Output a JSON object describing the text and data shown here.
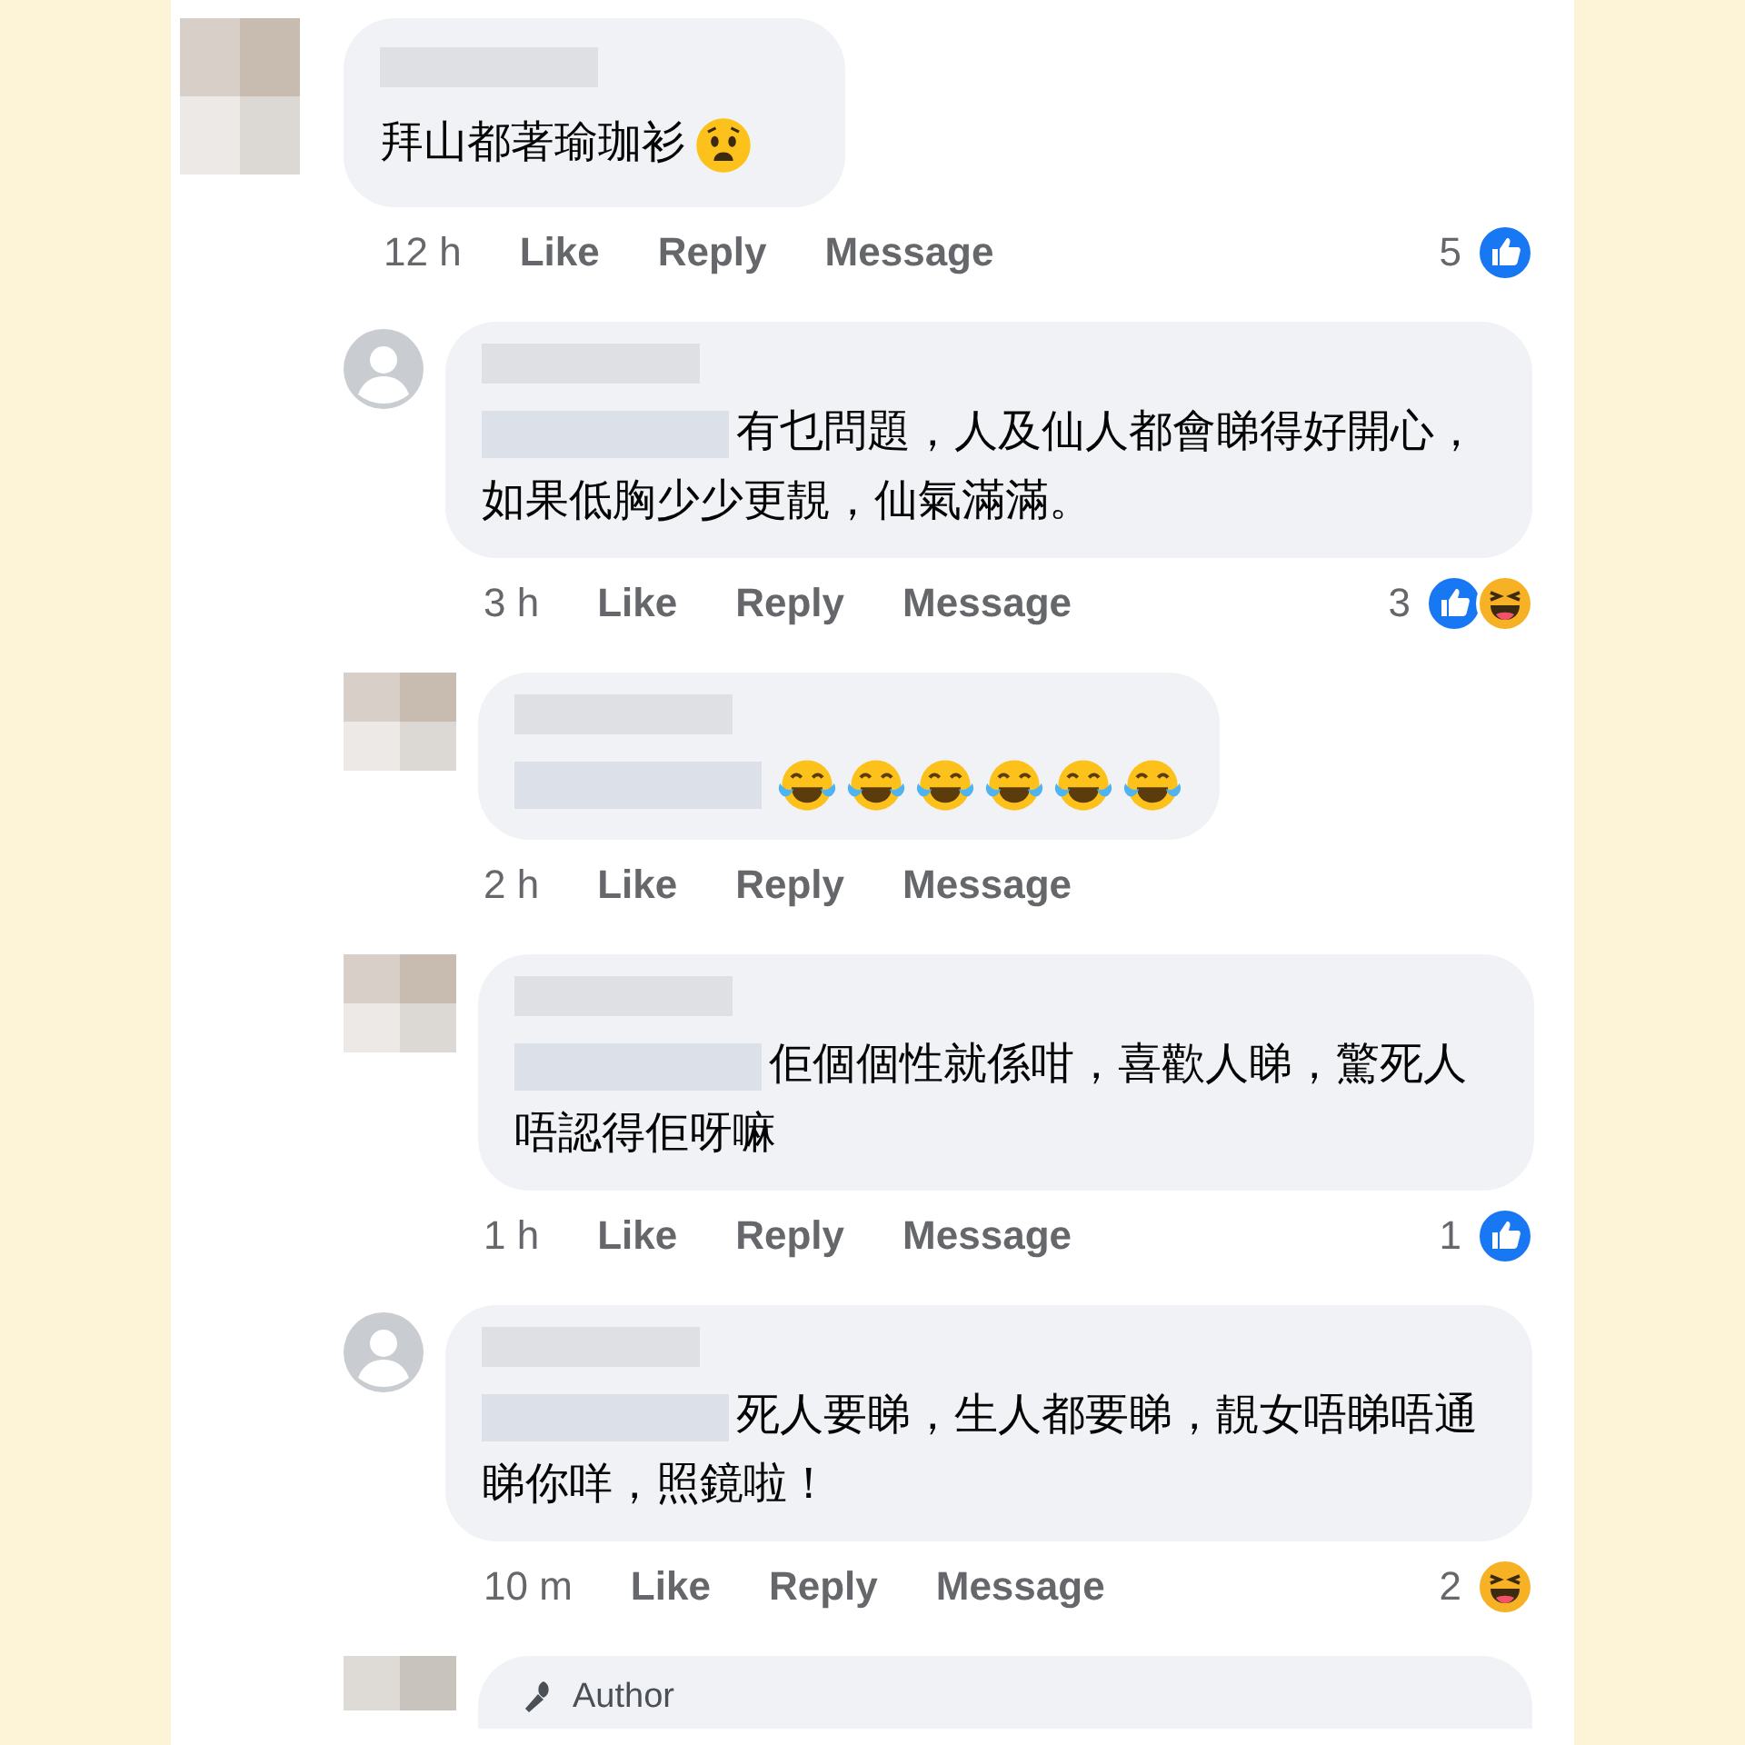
{
  "comments": [
    {
      "avatar": {
        "kind": "blurred"
      },
      "mention_hidden": false,
      "text": "拜山都著瑜珈衫",
      "emoji": [
        {
          "kind": "anguished"
        }
      ],
      "time": "12 h",
      "actions": [
        "Like",
        "Reply",
        "Message"
      ],
      "reaction_count": "5",
      "reactions": [
        {
          "kind": "like"
        }
      ],
      "replies": [
        {
          "avatar": {
            "kind": "default"
          },
          "mention_hidden": true,
          "text": "有乜問題，人及仙人都會睇得好開心，如果低胸少少更靚，仙氣滿滿。",
          "time": "3 h",
          "actions": [
            "Like",
            "Reply",
            "Message"
          ],
          "reaction_count": "3",
          "reactions": [
            {
              "kind": "like"
            },
            {
              "kind": "haha"
            }
          ]
        },
        {
          "avatar": {
            "kind": "blurred"
          },
          "mention_hidden": true,
          "emoji": [
            {
              "kind": "tears"
            },
            {
              "kind": "tears"
            },
            {
              "kind": "tears"
            },
            {
              "kind": "tears"
            },
            {
              "kind": "tears"
            },
            {
              "kind": "tears"
            }
          ],
          "time": "2 h",
          "actions": [
            "Like",
            "Reply",
            "Message"
          ]
        },
        {
          "avatar": {
            "kind": "blurred"
          },
          "mention_hidden": true,
          "text": "佢個個性就係咁，喜歡人睇，驚死人唔認得佢呀嘛",
          "time": "1 h",
          "actions": [
            "Like",
            "Reply",
            "Message"
          ],
          "reaction_count": "1",
          "reactions": [
            {
              "kind": "like"
            }
          ]
        },
        {
          "avatar": {
            "kind": "default"
          },
          "mention_hidden": true,
          "text": "死人要睇，生人都要睇，靚女唔睇唔通睇你咩，照鏡啦！",
          "time": "10 m",
          "actions": [
            "Like",
            "Reply",
            "Message"
          ],
          "reaction_count": "2",
          "reactions": [
            {
              "kind": "haha"
            }
          ]
        },
        {
          "avatar": {
            "kind": "blurred"
          },
          "badge": "Author"
        }
      ]
    }
  ]
}
